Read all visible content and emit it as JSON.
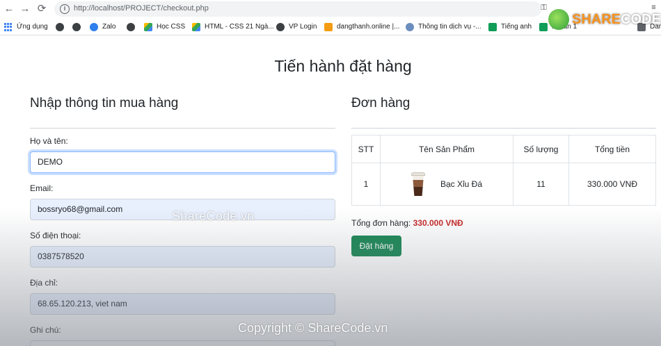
{
  "browser": {
    "back": "←",
    "forward": "→",
    "reload": "⟳",
    "url": "http://localhost/PROJECT/checkout.php",
    "bookmarks": [
      {
        "label": "Ứng dụng",
        "icon": "apps-grid-icon"
      },
      {
        "label": "",
        "icon": "globe-icon"
      },
      {
        "label": "",
        "icon": "globe-icon"
      },
      {
        "label": "Zalo",
        "icon": "zalo-icon"
      },
      {
        "label": "",
        "icon": "globe-icon"
      },
      {
        "label": "Học CSS",
        "icon": "drive-icon"
      },
      {
        "label": "HTML - CSS 21 Ngà...",
        "icon": "drive-icon"
      },
      {
        "label": "VP Login",
        "icon": "globe-icon"
      },
      {
        "label": "dangthanh.online |...",
        "icon": "site-icon"
      },
      {
        "label": "Thông tin dịch vụ -...",
        "icon": "globe-icon"
      },
      {
        "label": "Tiếng anh",
        "icon": "classroom-icon"
      },
      {
        "label": "Dự án 1",
        "icon": "classroom-icon"
      },
      {
        "label": "Dan",
        "icon": "reading-list-icon"
      }
    ]
  },
  "page": {
    "title": "Tiến hành đặt hàng"
  },
  "form": {
    "title": "Nhập thông tin mua hàng",
    "name_label": "Họ và tên:",
    "name_value": "DEMO",
    "email_label": "Email:",
    "email_value": "bossryo68@gmail.com",
    "phone_label": "Số điện thoại:",
    "phone_value": "0387578520",
    "address_label": "Địa chỉ:",
    "address_value": "68.65.120.213, viet nam",
    "note_label": "Ghi chú:"
  },
  "order": {
    "title": "Đơn hàng",
    "columns": [
      "STT",
      "Tên Sản Phẩm",
      "Số lượng",
      "Tổng tiền"
    ],
    "rows": [
      {
        "stt": "1",
        "product": "Bạc Xỉu Đá",
        "quantity": "11",
        "total": "330.000 VNĐ"
      }
    ],
    "total_label": "Tổng đơn hàng:",
    "total_value": "330.000 VNĐ",
    "submit_label": "Đặt hàng"
  },
  "watermark": {
    "logo_prefix": "SHARE",
    "logo_suffix": "CODE.vn",
    "center": "ShareCode.vn",
    "bottom": "Copyright © ShareCode.vn"
  },
  "colors": {
    "accent_green": "#198754",
    "price_red": "#c62828",
    "autofill_blue": "#e8f0fe"
  }
}
